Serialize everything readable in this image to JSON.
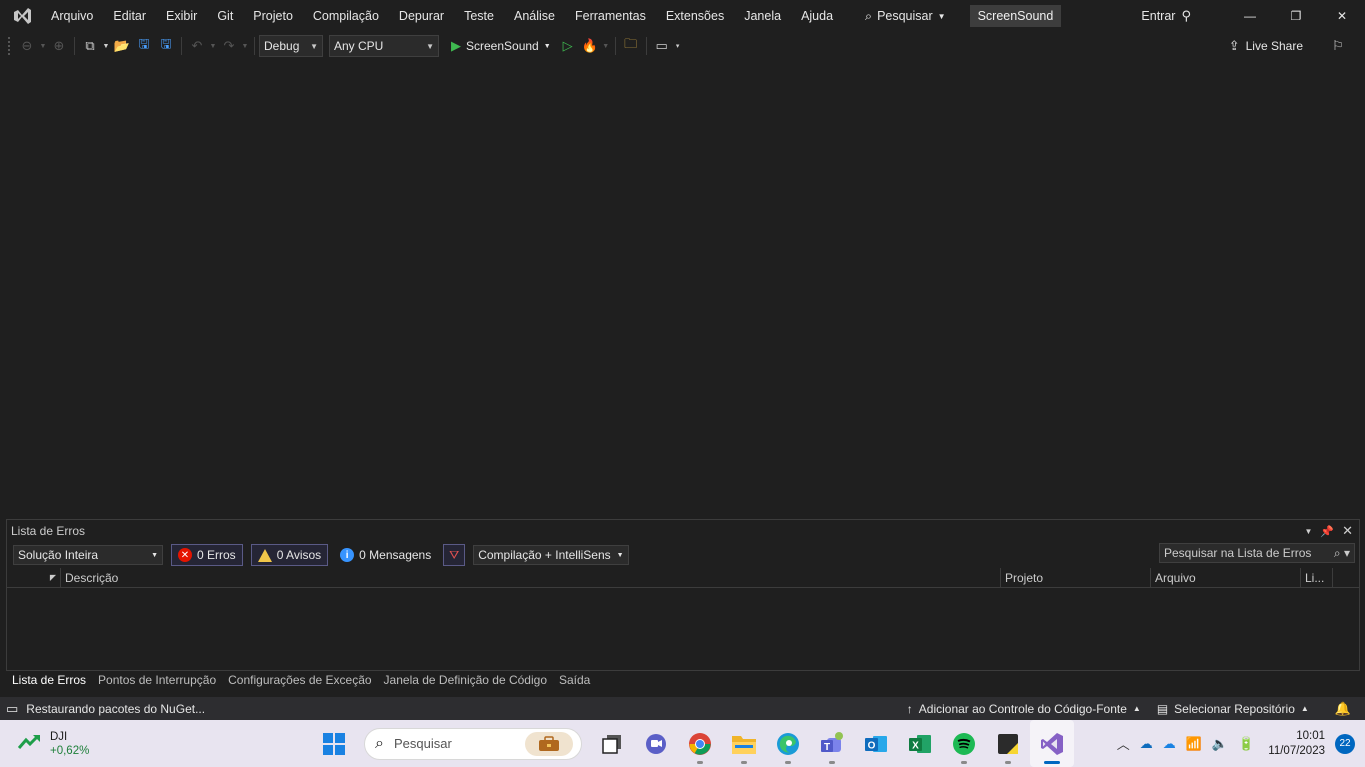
{
  "menu": {
    "items": [
      "Arquivo",
      "Editar",
      "Exibir",
      "Git",
      "Projeto",
      "Compilação",
      "Depurar",
      "Teste",
      "Análise",
      "Ferramentas",
      "Extensões",
      "Janela",
      "Ajuda"
    ],
    "search_label": "Pesquisar",
    "solution_name": "ScreenSound",
    "signin_label": "Entrar"
  },
  "toolbar": {
    "config": "Debug",
    "platform": "Any CPU",
    "startup_project": "ScreenSound",
    "live_share": "Live Share"
  },
  "error_list": {
    "title": "Lista de Erros",
    "scope": "Solução Inteira",
    "errors_label": "0 Erros",
    "warnings_label": "0 Avisos",
    "messages_label": "0 Mensagens",
    "build_filter": "Compilação + IntelliSens",
    "search_placeholder": "Pesquisar na Lista de Erros",
    "columns": [
      "Descrição",
      "Projeto",
      "Arquivo",
      "Li..."
    ]
  },
  "bottom_tabs": [
    "Lista de Erros",
    "Pontos de Interrupção",
    "Configurações de Exceção",
    "Janela de Definição de Código",
    "Saída"
  ],
  "status": {
    "message": "Restaurando pacotes do NuGet...",
    "source_control": "Adicionar ao Controle do Código-Fonte",
    "repository": "Selecionar Repositório"
  },
  "taskbar": {
    "stock_name": "DJI",
    "stock_change": "+0,62%",
    "search_placeholder": "Pesquisar",
    "time": "10:01",
    "date": "11/07/2023",
    "notifications": "22"
  },
  "colors": {
    "vs_purple": "#8661c5",
    "run_green": "#3fb950",
    "error_red": "#e51400",
    "warning_yellow": "#f0c64a",
    "info_blue": "#3794ff"
  }
}
